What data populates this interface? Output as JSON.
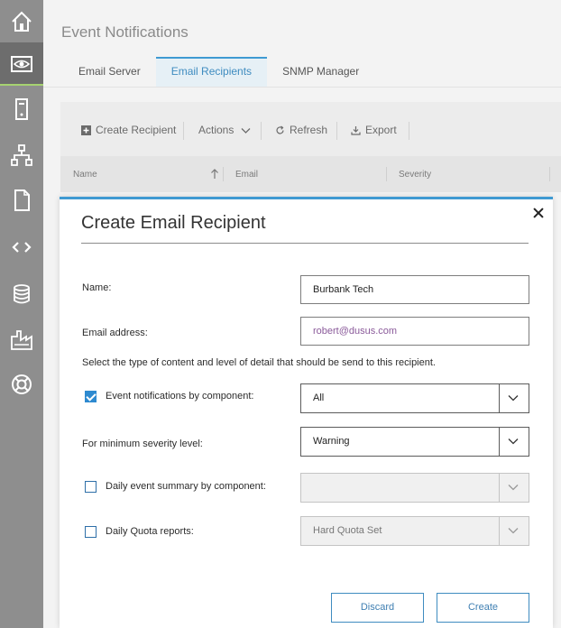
{
  "header": {
    "title": "Event Notifications"
  },
  "tabs": [
    {
      "label": "Email Server",
      "active": false
    },
    {
      "label": "Email Recipients",
      "active": true
    },
    {
      "label": "SNMP Manager",
      "active": false
    }
  ],
  "sidebar": {
    "items": [
      {
        "icon": "home-icon"
      },
      {
        "icon": "monitoring-eye-icon",
        "active": true
      },
      {
        "icon": "server-icon"
      },
      {
        "icon": "network-topology-icon"
      },
      {
        "icon": "document-icon"
      },
      {
        "icon": "code-icon"
      },
      {
        "icon": "database-icon"
      },
      {
        "icon": "factory-icon"
      },
      {
        "icon": "help-lifebuoy-icon"
      }
    ]
  },
  "toolbar": {
    "create": "Create Recipient",
    "actions": "Actions",
    "refresh": "Refresh",
    "export": "Export"
  },
  "table": {
    "columns": [
      "Name",
      "Email",
      "Severity"
    ]
  },
  "modal": {
    "title": "Create Email Recipient",
    "name_label": "Name:",
    "name_value": "Burbank Tech",
    "email_label": "Email address:",
    "email_value": "robert@dusus.com",
    "instructions": "Select the type of content and level of detail that should be send to this recipient.",
    "event_notifications_label": "Event notifications by component:",
    "event_notifications_checked": true,
    "event_notifications_value": "All",
    "min_severity_label": "For minimum severity level:",
    "min_severity_value": "Warning",
    "daily_summary_label": "Daily event summary by component:",
    "daily_summary_checked": false,
    "daily_summary_value": "",
    "quota_label": "Daily Quota reports:",
    "quota_checked": false,
    "quota_value": "Hard Quota Set",
    "discard": "Discard",
    "create": "Create"
  },
  "colors": {
    "accent": "#3f9ad2",
    "rail": "#8e8e8e",
    "rail_active": "#6d6d6d",
    "active_indicator": "#a6d271"
  }
}
